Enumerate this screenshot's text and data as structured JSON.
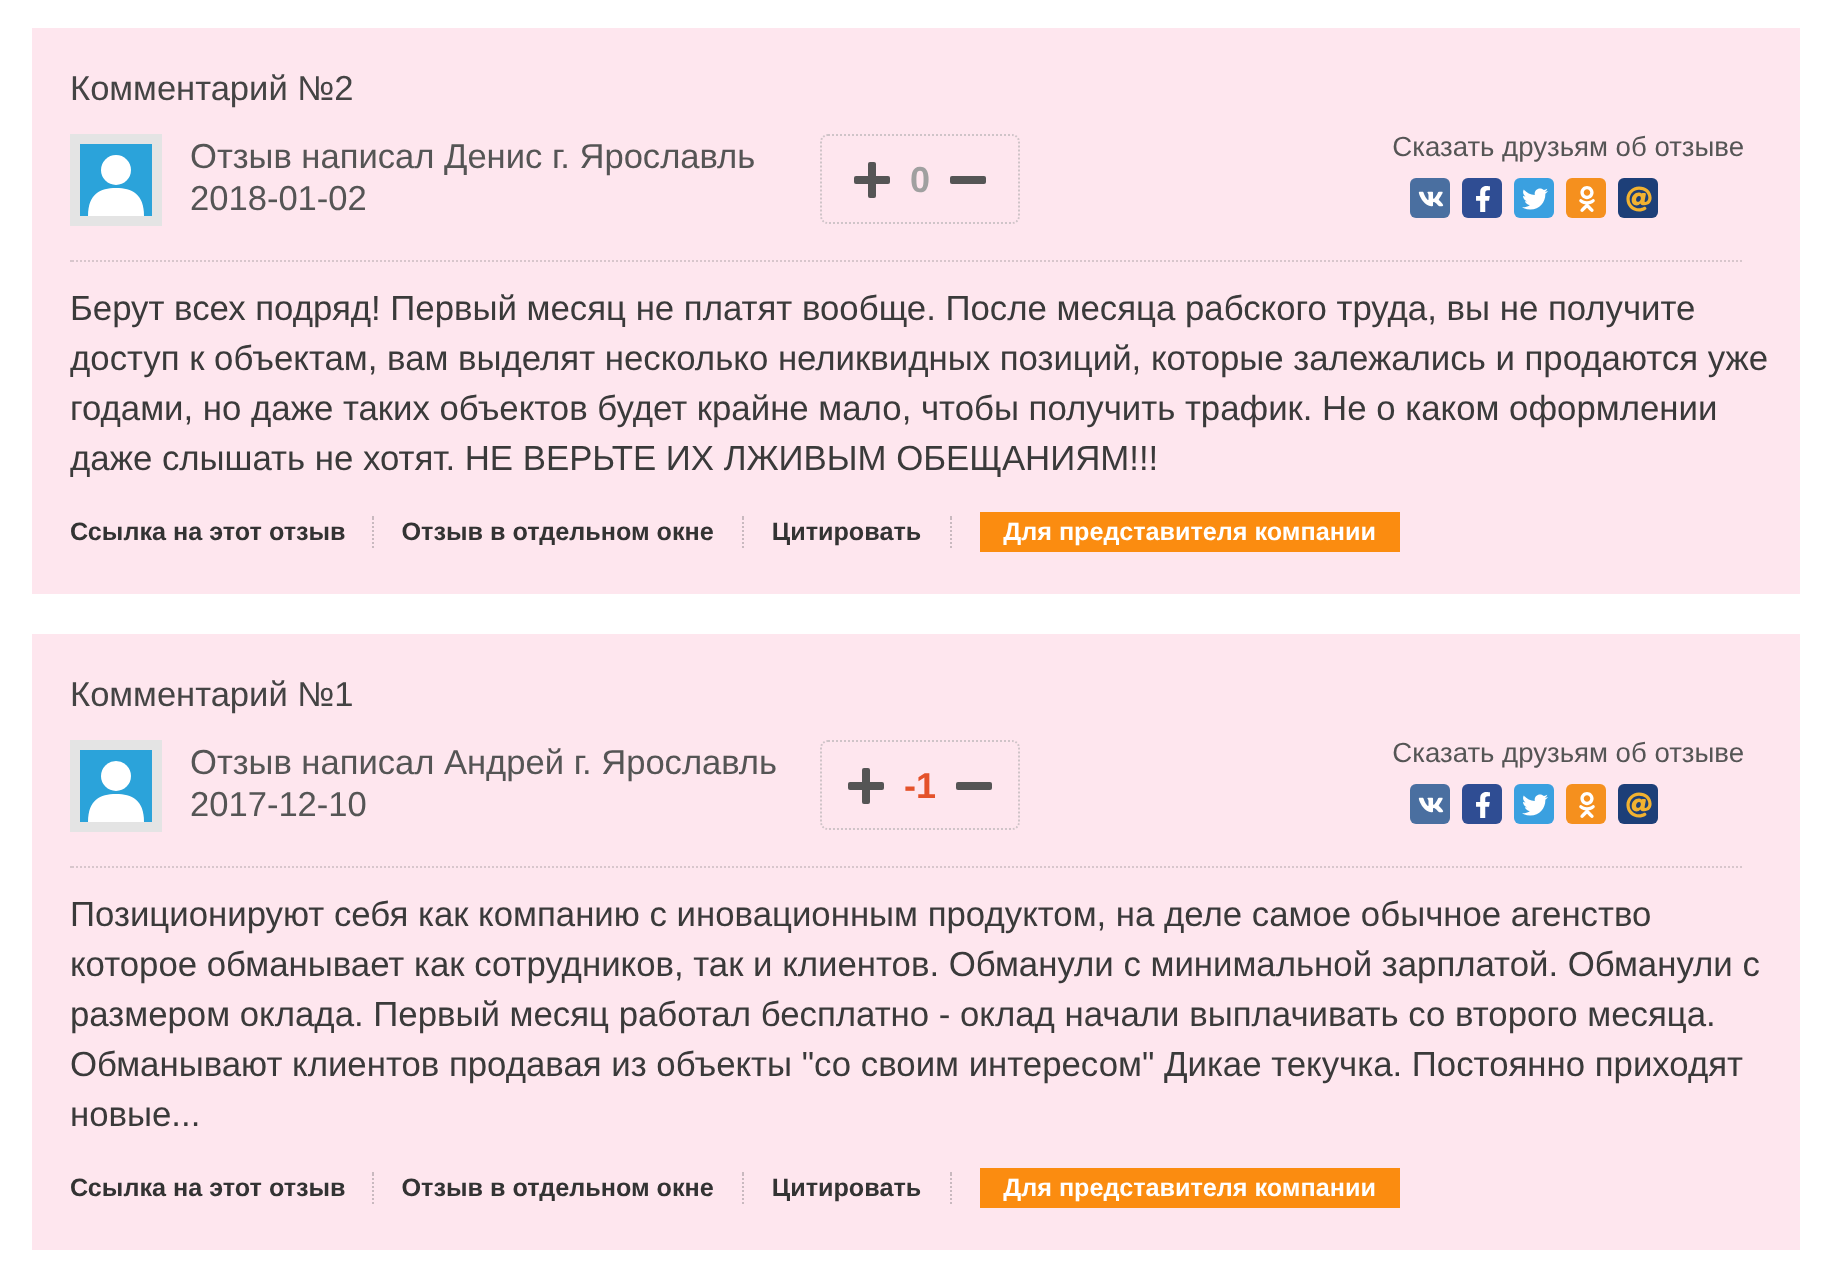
{
  "comments": [
    {
      "title": "Комментарий №2",
      "author": "Отзыв написал Денис г. Ярославль",
      "date": "2018-01-02",
      "vote": {
        "score": "0",
        "color": "#a0a0a0"
      },
      "share_label": "Сказать друзьям об отзыве",
      "text": "Берут всех подряд! Первый месяц не платят вообще. После месяца рабского труда, вы не получите доступ к объектам, вам выделят несколько неликвидных позиций, которые залежались и продаются уже годами, но даже таких объектов будет крайне мало, чтобы получить трафик. Не о каком оформлении даже слышать не хотят. НЕ ВЕРЬТЕ ИХ ЛЖИВЫМ ОБЕЩАНИЯМ!!!",
      "links": [
        "Ссылка на этот отзыв",
        "Отзыв в отдельном окне",
        "Цитировать"
      ],
      "company_button": "Для представителя компании"
    },
    {
      "title": "Комментарий №1",
      "author": "Отзыв написал Андрей г. Ярославль",
      "date": "2017-12-10",
      "vote": {
        "score": "-1",
        "color": "#e4522a"
      },
      "share_label": "Сказать друзьям об отзыве",
      "text": "Позиционируют себя как компанию с иновационным продуктом, на деле самое обычное агенство которое обманывает как сотрудников, так и клиентов. Обманули с минимальной зарплатой. Обманули с размером оклада. Первый месяц работал бесплатно - оклад начали выплачивать со второго месяца. Обманывают клиентов продавая из объекты \"со своим интересом\" Дикае текучка. Постоянно приходят новые...",
      "links": [
        "Ссылка на этот отзыв",
        "Отзыв в отдельном окне",
        "Цитировать"
      ],
      "company_button": "Для представителя компании"
    }
  ]
}
